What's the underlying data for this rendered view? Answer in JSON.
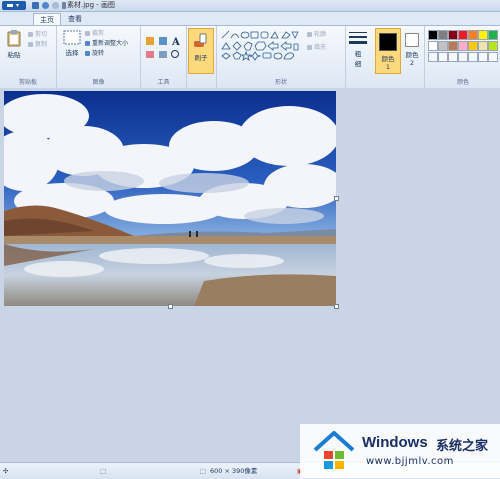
{
  "window": {
    "title": "素材.jpg - 画图"
  },
  "tabs": [
    {
      "label": "主页",
      "active": true
    },
    {
      "label": "查看",
      "active": false
    }
  ],
  "ribbon": {
    "clipboard": {
      "paste": "粘贴",
      "cut": "剪切",
      "copy": "复制",
      "label": "剪贴板"
    },
    "image": {
      "select": "选择",
      "crop": "裁剪",
      "resize": "重新调整大小",
      "rotate": "旋转",
      "label": "图像"
    },
    "tools": {
      "label": "工具"
    },
    "brushes": {
      "label": "刷子"
    },
    "shapes": {
      "outline": "轮廓",
      "fill": "填充",
      "label": "形状"
    },
    "size": {
      "label": "粗细"
    },
    "color1": {
      "label": "颜色 1",
      "value": "#000000"
    },
    "color2": {
      "label": "颜色 2",
      "value": "#ffffff"
    },
    "colors": {
      "label": "颜色",
      "palette_row1": [
        "#000000",
        "#7f7f7f",
        "#880015",
        "#ed1c24",
        "#ff7f27",
        "#fff200",
        "#22b14c",
        "#00a2e8",
        "#3f48cc",
        "#a349a4"
      ],
      "palette_row2": [
        "#ffffff",
        "#c3c3c3",
        "#b97a57",
        "#ffaec9",
        "#ffc90e",
        "#efe4b0",
        "#b5e61d",
        "#99d9ea",
        "#7092be",
        "#c8bfe7"
      ]
    }
  },
  "statusbar": {
    "image_size": "600 × 390像素"
  },
  "watermark": {
    "brand": "Windows",
    "brand_cn": "系统之家",
    "url": "www.bjjmlv.com"
  }
}
